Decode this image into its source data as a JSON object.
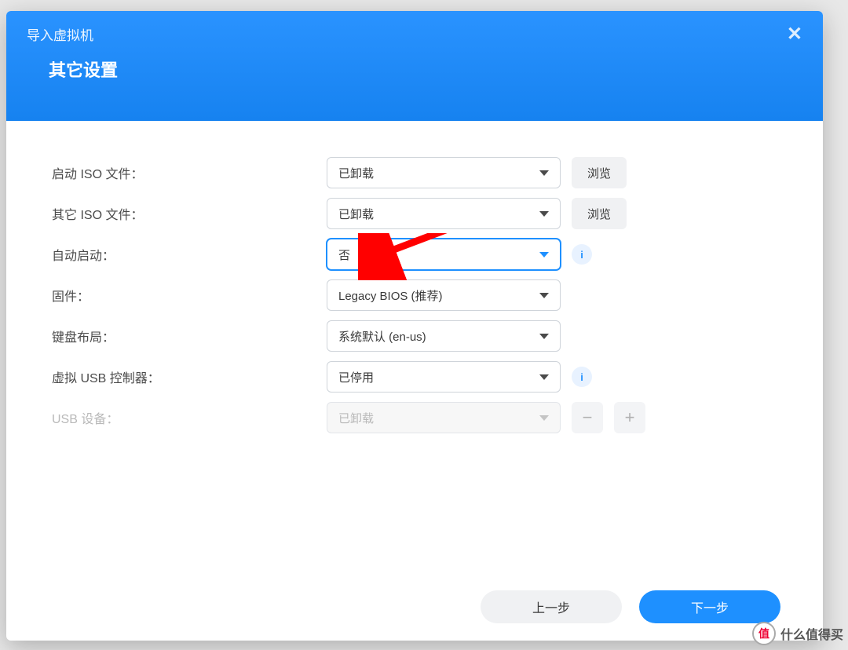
{
  "header": {
    "title": "导入虚拟机",
    "subtitle": "其它设置"
  },
  "rows": {
    "boot_iso": {
      "label": "启动 ISO 文件：",
      "value": "已卸载",
      "browse": "浏览"
    },
    "other_iso": {
      "label": "其它 ISO 文件：",
      "value": "已卸载",
      "browse": "浏览"
    },
    "autostart": {
      "label": "自动启动：",
      "value": "否"
    },
    "firmware": {
      "label": "固件：",
      "value": "Legacy BIOS (推荐)"
    },
    "keyboard": {
      "label": "键盘布局：",
      "value": "系统默认 (en-us)"
    },
    "usb_ctrl": {
      "label": "虚拟 USB 控制器：",
      "value": "已停用"
    },
    "usb_dev": {
      "label": "USB 设备：",
      "value": "已卸载"
    }
  },
  "footer": {
    "prev": "上一步",
    "next": "下一步"
  },
  "watermark": {
    "badge": "值",
    "text": "什么值得买"
  }
}
